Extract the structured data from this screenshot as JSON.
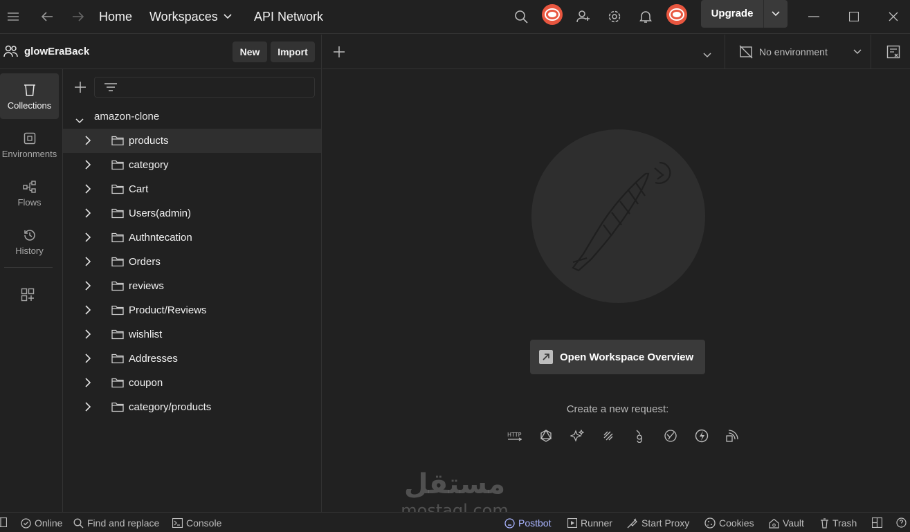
{
  "titlebar": {
    "nav_home": "Home",
    "nav_workspaces": "Workspaces",
    "nav_api_network": "API Network",
    "upgrade_label": "Upgrade"
  },
  "workspace": {
    "name": "glowEraBack",
    "new_label": "New",
    "import_label": "Import"
  },
  "environment": {
    "selected": "No environment"
  },
  "rail": {
    "items": [
      {
        "label": "Collections"
      },
      {
        "label": "Environments"
      },
      {
        "label": "Flows"
      },
      {
        "label": "History"
      }
    ]
  },
  "collection": {
    "name": "amazon-clone",
    "folders": [
      "products",
      "category",
      "Cart",
      "Users(admin)",
      "Authntecation",
      "Orders",
      "reviews",
      "Product/Reviews",
      "wishlist",
      "Addresses",
      "coupon",
      "category/products"
    ]
  },
  "main": {
    "open_overview_label": "Open Workspace Overview",
    "create_request_label": "Create a new request:"
  },
  "watermark": {
    "arabic": "مستقل",
    "latin": "mostaql.com"
  },
  "statusbar": {
    "online": "Online",
    "find_replace": "Find and replace",
    "console": "Console",
    "postbot": "Postbot",
    "runner": "Runner",
    "start_proxy": "Start Proxy",
    "cookies": "Cookies",
    "vault": "Vault",
    "trash": "Trash"
  },
  "colors": {
    "background": "#212121",
    "panel_border": "#333333",
    "accent_avatar": "#e8563f",
    "postbot": "#a9b4ff"
  }
}
